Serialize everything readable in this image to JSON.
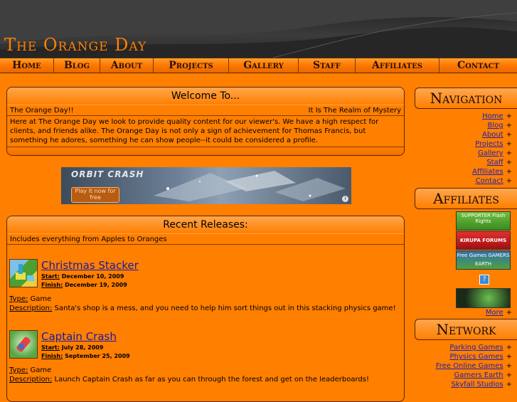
{
  "header": {
    "logo_text": "The Orange Day"
  },
  "nav": {
    "items": [
      "Home",
      "Blog",
      "About",
      "Projects",
      "Gallery",
      "Staff",
      "Affiliates",
      "Contact"
    ]
  },
  "welcome": {
    "title": "Welcome To...",
    "left_caption": "The Orange Day!!",
    "right_caption": "It Is The Realm of Mystery",
    "body": "Here at The Orange Day we look to provide quality content for our viewer's. We have a high respect for clients, and friends alike. The Orange Day is not only a sign of achievement for Thomas Francis, but something he adores, something he can show people--it could be considered a profile."
  },
  "banner_ad": {
    "brand": "ORBIT CRASH",
    "button_label": "Play it now for free",
    "info_glyph": "i"
  },
  "releases": {
    "title": "Recent Releases:",
    "subtitle": "Includes everything from Apples to Oranges",
    "start_label": "Start:",
    "finish_label": "Finish:",
    "type_label": "Type:",
    "description_label": "Description:",
    "items": [
      {
        "title": "Christmas Stacker",
        "start": "December 10, 2009",
        "finish": "December 19, 2009",
        "type": "Game",
        "description": "Santa's shop is a mess, and you need to help him sort things out in this stacking physics game!"
      },
      {
        "title": "Captain Crash",
        "start": "July 28, 2009",
        "finish": "September 25, 2009",
        "type": "Game",
        "description": "Launch Captain Crash as far as you can through the forest and get on the leaderboards!"
      }
    ]
  },
  "sidebar": {
    "navigation_title": "Navigation",
    "navigation_links": [
      "Home",
      "Blog",
      "About",
      "Projects",
      "Gallery",
      "Staff",
      "Affiliates",
      "Contact"
    ],
    "affiliates_title": "Affiliates",
    "affiliate_badges": [
      {
        "text": "SUPPORTER Flash Rights",
        "icon": "supporter-flash-badge"
      },
      {
        "text": "KIRUPA FORUMS",
        "icon": "kirupa-badge"
      },
      {
        "text": "Free Games GAMERS EARTH",
        "icon": "gamers-earth-badge"
      }
    ],
    "more_link": "More",
    "network_title": "Network",
    "network_links": [
      "Parking Games",
      "Physics Games",
      "Free Online Games",
      "Gamers Earth",
      "Skyfall Studios"
    ],
    "plus_glyph": "+"
  },
  "colors": {
    "page_bg": "#ff7f00",
    "header_bg": "#2a2a2a",
    "logo": "#ff8000",
    "link": "#2020b0"
  }
}
